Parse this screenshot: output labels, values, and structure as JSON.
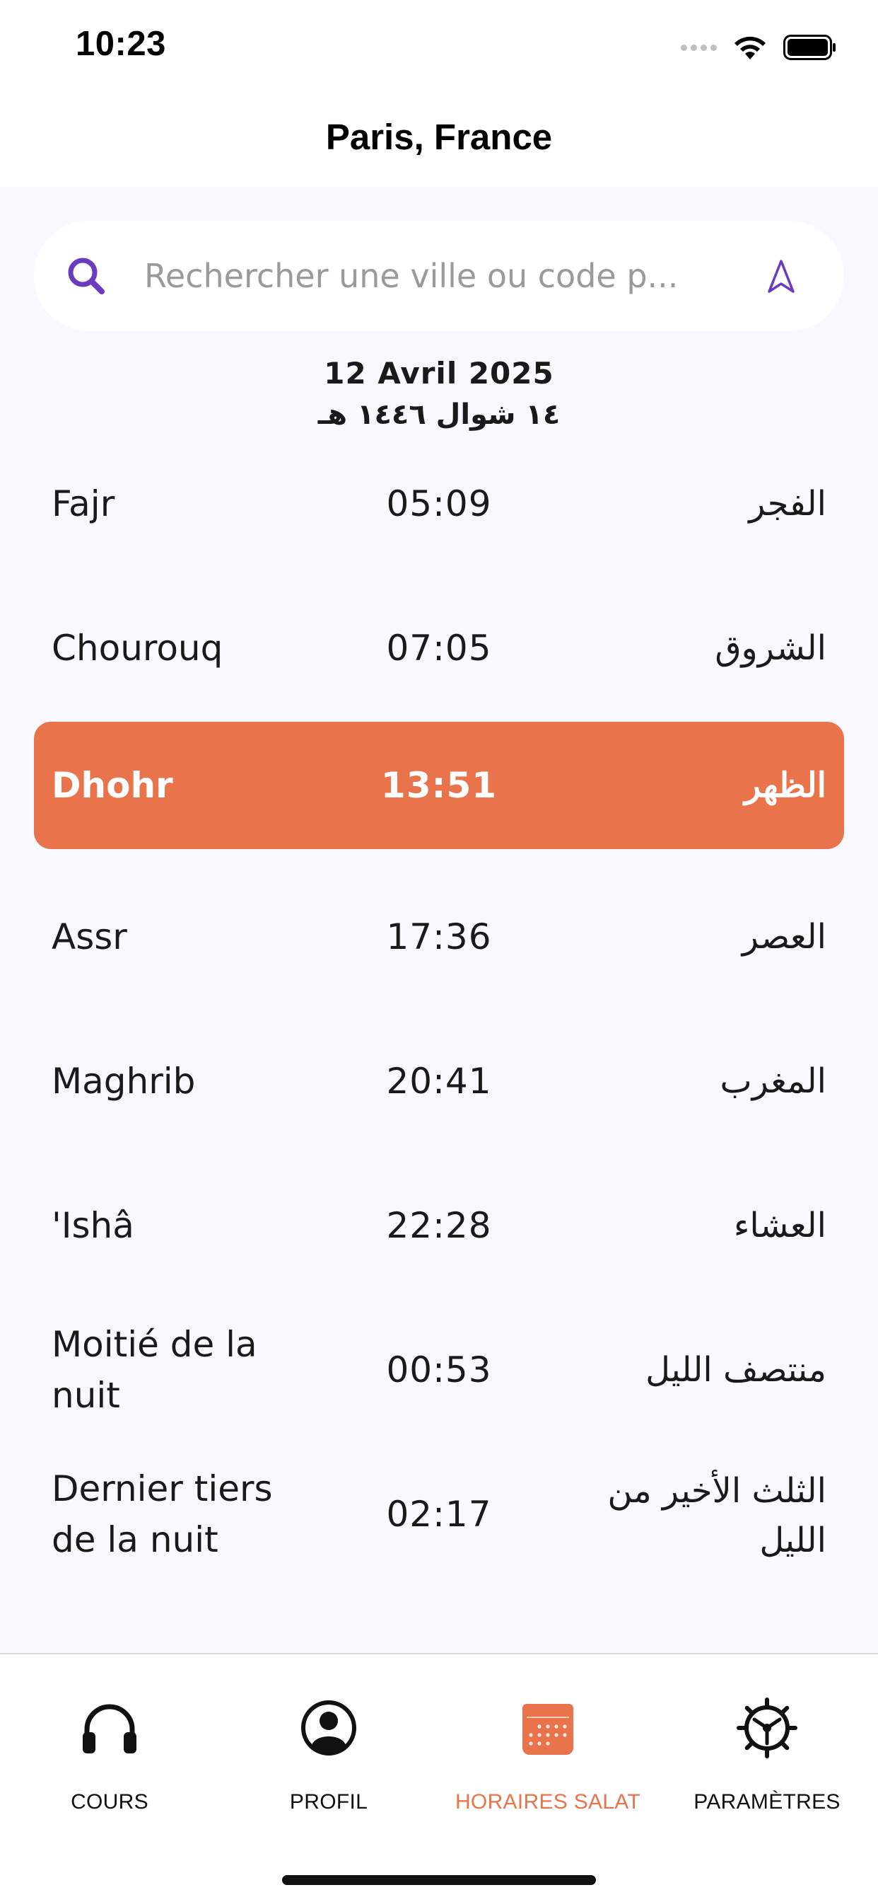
{
  "status_bar": {
    "time": "10:23",
    "icons": [
      "signal-icon",
      "wifi-icon",
      "battery-icon"
    ]
  },
  "header": {
    "title": "Paris, France"
  },
  "search": {
    "placeholder": "Rechercher une ville ou code p...",
    "value": "",
    "icon": "search-icon",
    "location_icon": "location-arrow-icon"
  },
  "date": {
    "gregorian": "12 Avril 2025",
    "hijri": "١٤ شوال ١٤٤٦ هـ"
  },
  "prayers": [
    {
      "name": "Fajr",
      "time": "05:09",
      "arabic": "الفجر",
      "active": false
    },
    {
      "name": "Chourouq",
      "time": "07:05",
      "arabic": "الشروق",
      "active": false
    },
    {
      "name": "Dhohr",
      "time": "13:51",
      "arabic": "الظهر",
      "active": true
    },
    {
      "name": "Assr",
      "time": "17:36",
      "arabic": "العصر",
      "active": false
    },
    {
      "name": "Maghrib",
      "time": "20:41",
      "arabic": "المغرب",
      "active": false
    },
    {
      "name": "'Ishâ",
      "time": "22:28",
      "arabic": "العشاء",
      "active": false
    },
    {
      "name": "Moitié de la nuit",
      "time": "00:53",
      "arabic": "منتصف الليل",
      "active": false
    },
    {
      "name": "Dernier tiers de la nuit",
      "time": "02:17",
      "arabic": "الثلث الأخير من الليل",
      "active": false
    }
  ],
  "tabs": [
    {
      "label": "COURS",
      "icon": "headphones-icon",
      "active": false
    },
    {
      "label": "PROFIL",
      "icon": "user-circle-icon",
      "active": false
    },
    {
      "label": "HORAIRES SALAT",
      "icon": "calendar-icon",
      "active": true
    },
    {
      "label": "PARAMÈTRES",
      "icon": "gear-icon",
      "active": false
    }
  ],
  "colors": {
    "accent": "#e9744b",
    "search_icon": "#6a3bbf",
    "background": "#f8f8fe",
    "text": "#1a1a1a"
  }
}
